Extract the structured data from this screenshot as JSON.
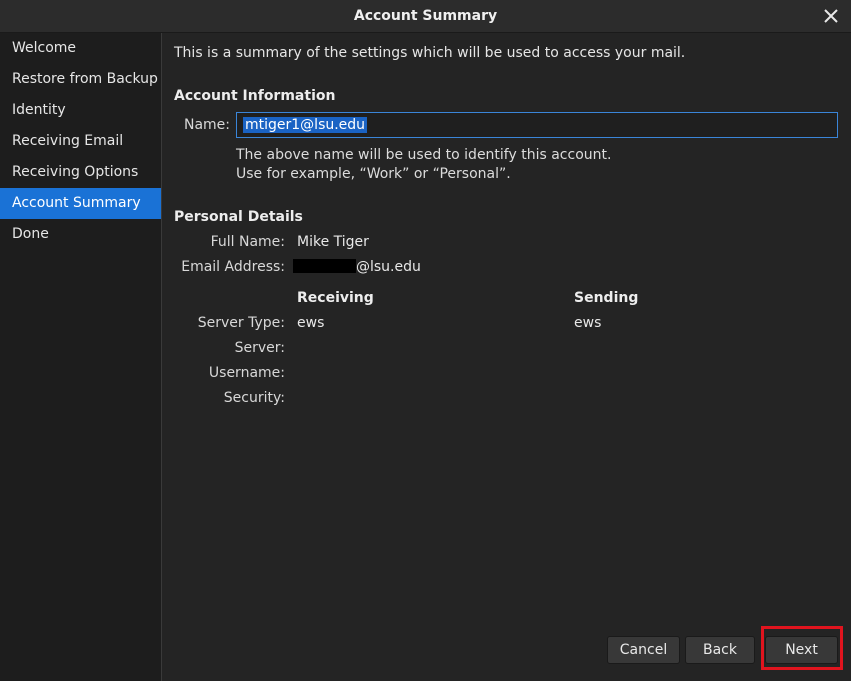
{
  "window": {
    "title": "Account Summary"
  },
  "sidebar": {
    "items": [
      {
        "label": "Welcome"
      },
      {
        "label": "Restore from Backup"
      },
      {
        "label": "Identity"
      },
      {
        "label": "Receiving Email"
      },
      {
        "label": "Receiving Options"
      },
      {
        "label": "Account Summary",
        "selected": true
      },
      {
        "label": "Done"
      }
    ]
  },
  "main": {
    "intro": "This is a summary of the settings which will be used to access your mail.",
    "account_info": {
      "heading": "Account Information",
      "name_label": "Name:",
      "name_value": "mtiger1@lsu.edu",
      "hint_line1": "The above name will be used to identify this account.",
      "hint_line2": "Use for example, “Work” or “Personal”."
    },
    "personal": {
      "heading": "Personal Details",
      "full_name_label": "Full Name:",
      "full_name_value": "Mike Tiger",
      "email_label": "Email Address:",
      "email_suffix": "@lsu.edu"
    },
    "servers": {
      "receiving_heading": "Receiving",
      "sending_heading": "Sending",
      "server_type_label": "Server Type:",
      "server_label": "Server:",
      "username_label": "Username:",
      "security_label": "Security:",
      "receiving_type": "ews",
      "sending_type": "ews"
    }
  },
  "buttons": {
    "cancel": "Cancel",
    "back": "Back",
    "next": "Next"
  },
  "colors": {
    "selection": "#1a72d6",
    "highlight_box": "#e0141e"
  }
}
